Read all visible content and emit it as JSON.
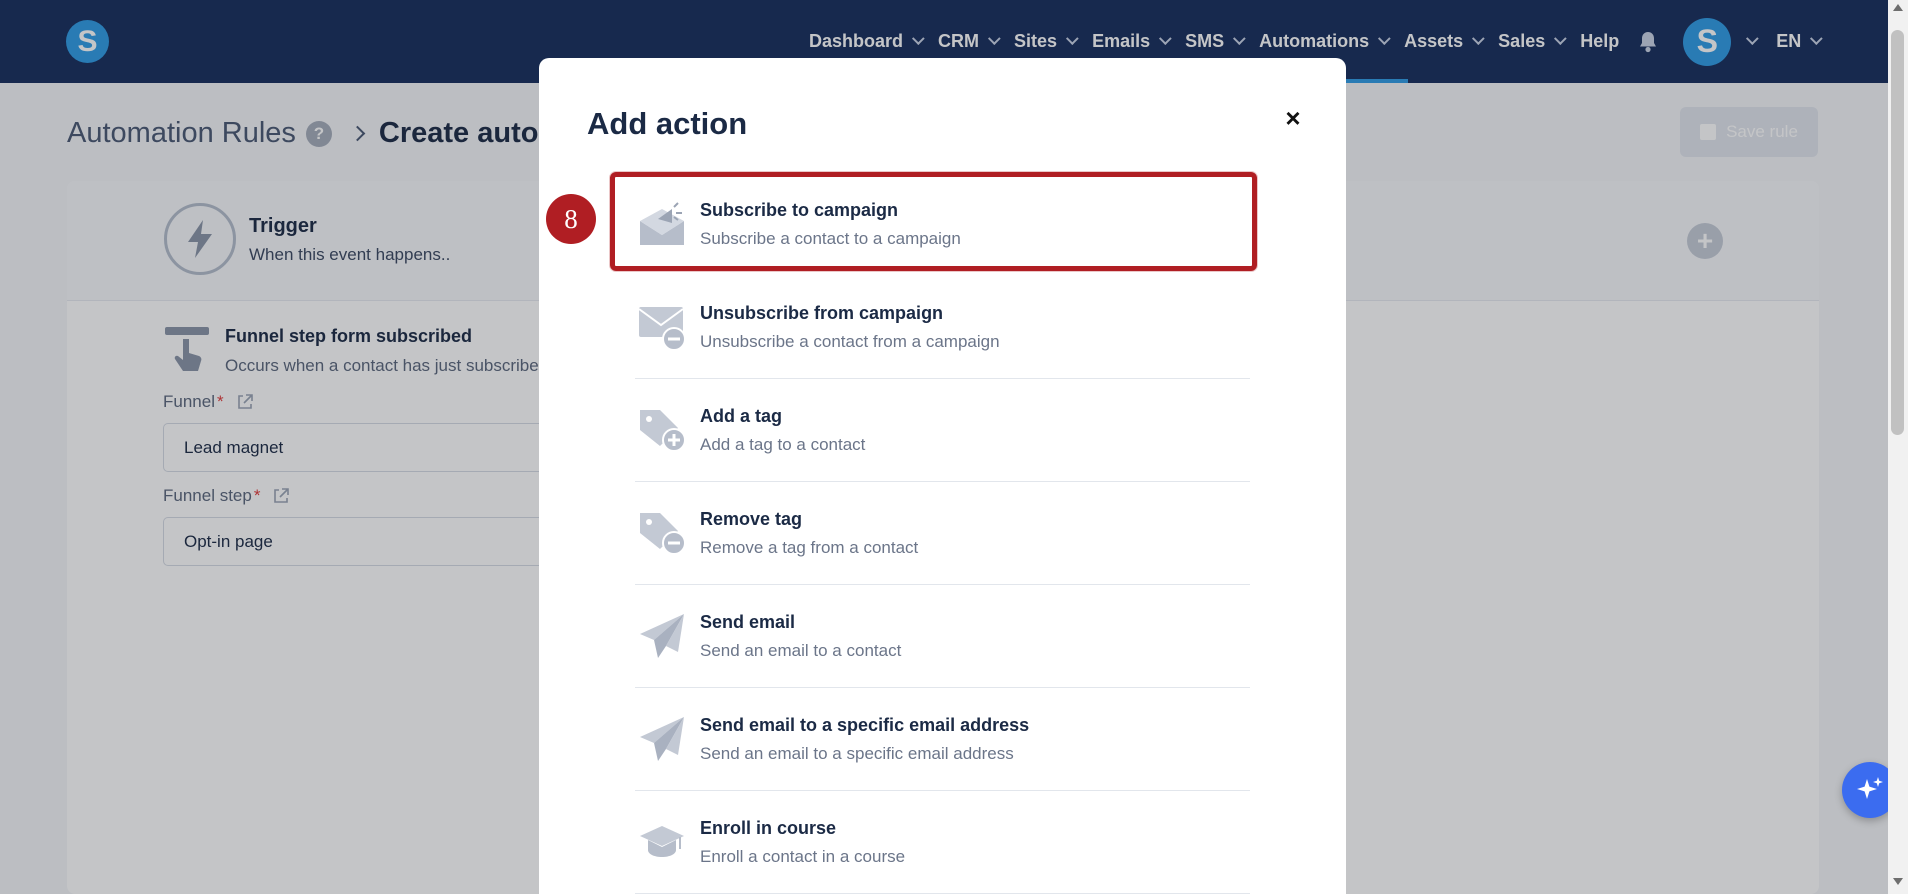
{
  "nav": {
    "logo_letter": "S",
    "items": [
      {
        "label": "Dashboard",
        "has_dropdown": true
      },
      {
        "label": "CRM",
        "has_dropdown": true
      },
      {
        "label": "Sites",
        "has_dropdown": true
      },
      {
        "label": "Emails",
        "has_dropdown": true
      },
      {
        "label": "SMS",
        "has_dropdown": true
      },
      {
        "label": "Automations",
        "has_dropdown": true,
        "active": true
      },
      {
        "label": "Assets",
        "has_dropdown": true
      },
      {
        "label": "Sales",
        "has_dropdown": true
      },
      {
        "label": "Help",
        "has_dropdown": false
      }
    ],
    "avatar_letter": "S",
    "language": "EN",
    "accent_color": "#2f9be6",
    "bar_color": "#162d5c"
  },
  "page": {
    "breadcrumb_root": "Automation Rules",
    "help_glyph": "?",
    "breadcrumb_current": "Create autom",
    "save_label": "Save rule",
    "trigger": {
      "title": "Trigger",
      "subtitle": "When this event happens.."
    },
    "event": {
      "title": "Funnel step form subscribed",
      "subtitle": "Occurs when a contact has just subscribe"
    },
    "fields": [
      {
        "label": "Funnel",
        "required": true,
        "value": "Lead magnet"
      },
      {
        "label": "Funnel step",
        "required": true,
        "value": "Opt-in page"
      }
    ]
  },
  "modal": {
    "title": "Add action",
    "close_glyph": "×",
    "step_number": "8",
    "highlight_color": "#b01e23",
    "actions": [
      {
        "icon": "envelope-megaphone-icon",
        "title": "Subscribe to campaign",
        "subtitle": "Subscribe a contact to a campaign",
        "highlighted": true
      },
      {
        "icon": "envelope-minus-icon",
        "title": "Unsubscribe from campaign",
        "subtitle": "Unsubscribe a contact from a campaign"
      },
      {
        "icon": "tag-plus-icon",
        "title": "Add a tag",
        "subtitle": "Add a tag to a contact"
      },
      {
        "icon": "tag-minus-icon",
        "title": "Remove tag",
        "subtitle": "Remove a tag from a contact"
      },
      {
        "icon": "paper-plane-icon",
        "title": "Send email",
        "subtitle": "Send an email to a contact"
      },
      {
        "icon": "paper-plane-icon",
        "title": "Send email to a specific email address",
        "subtitle": "Send an email to a specific email address"
      },
      {
        "icon": "graduation-cap-icon",
        "title": "Enroll in course",
        "subtitle": "Enroll a contact in a course"
      }
    ]
  }
}
